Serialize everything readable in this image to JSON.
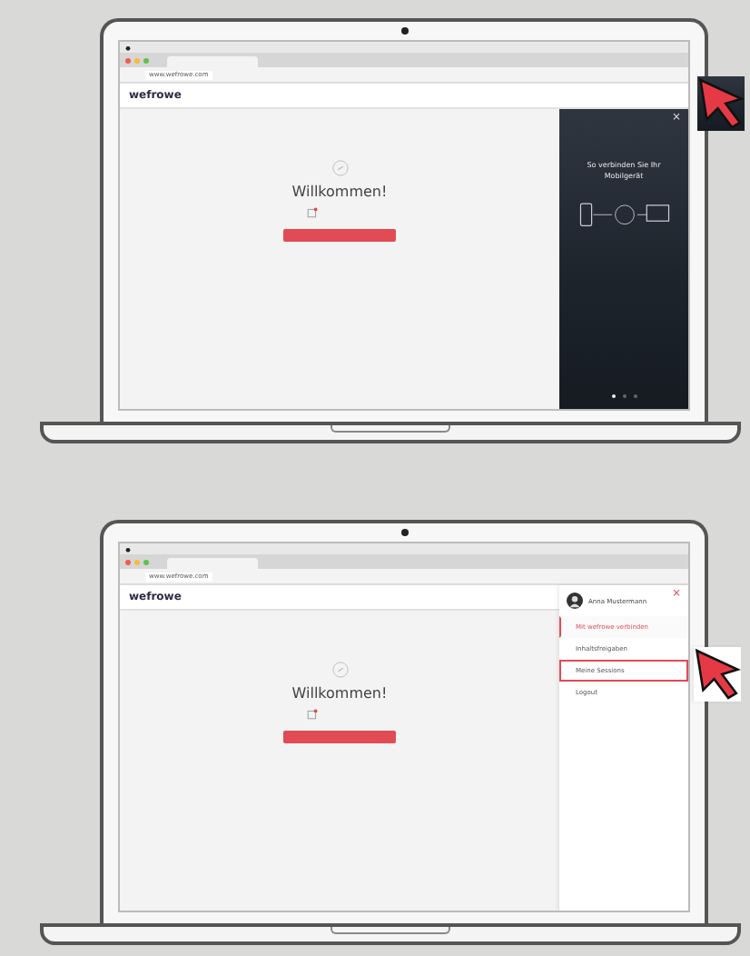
{
  "laptops": [
    {
      "url": "www.wefrowe.com",
      "logo": "wefrowe",
      "welcome": "Willkommen!",
      "panel": {
        "kind": "promo",
        "close": "×",
        "heading": "So verbinden Sie Ihr Mobilgerät",
        "dots": [
          {
            "selected": true
          },
          {
            "selected": false
          },
          {
            "selected": false
          }
        ]
      }
    },
    {
      "url": "www.wefrowe.com",
      "logo": "wefrowe",
      "welcome": "Willkommen!",
      "panel": {
        "kind": "menu",
        "close": "×",
        "user_name": "Anna Mustermann",
        "items": [
          {
            "label": "Mit wefrowe verbinden",
            "selected": true,
            "highlighted": false
          },
          {
            "label": "Inhaltsfreigaben",
            "selected": false,
            "highlighted": false
          },
          {
            "label": "Meine Sessions",
            "selected": false,
            "highlighted": true
          },
          {
            "label": "Logout",
            "selected": false,
            "highlighted": false
          }
        ]
      }
    }
  ]
}
